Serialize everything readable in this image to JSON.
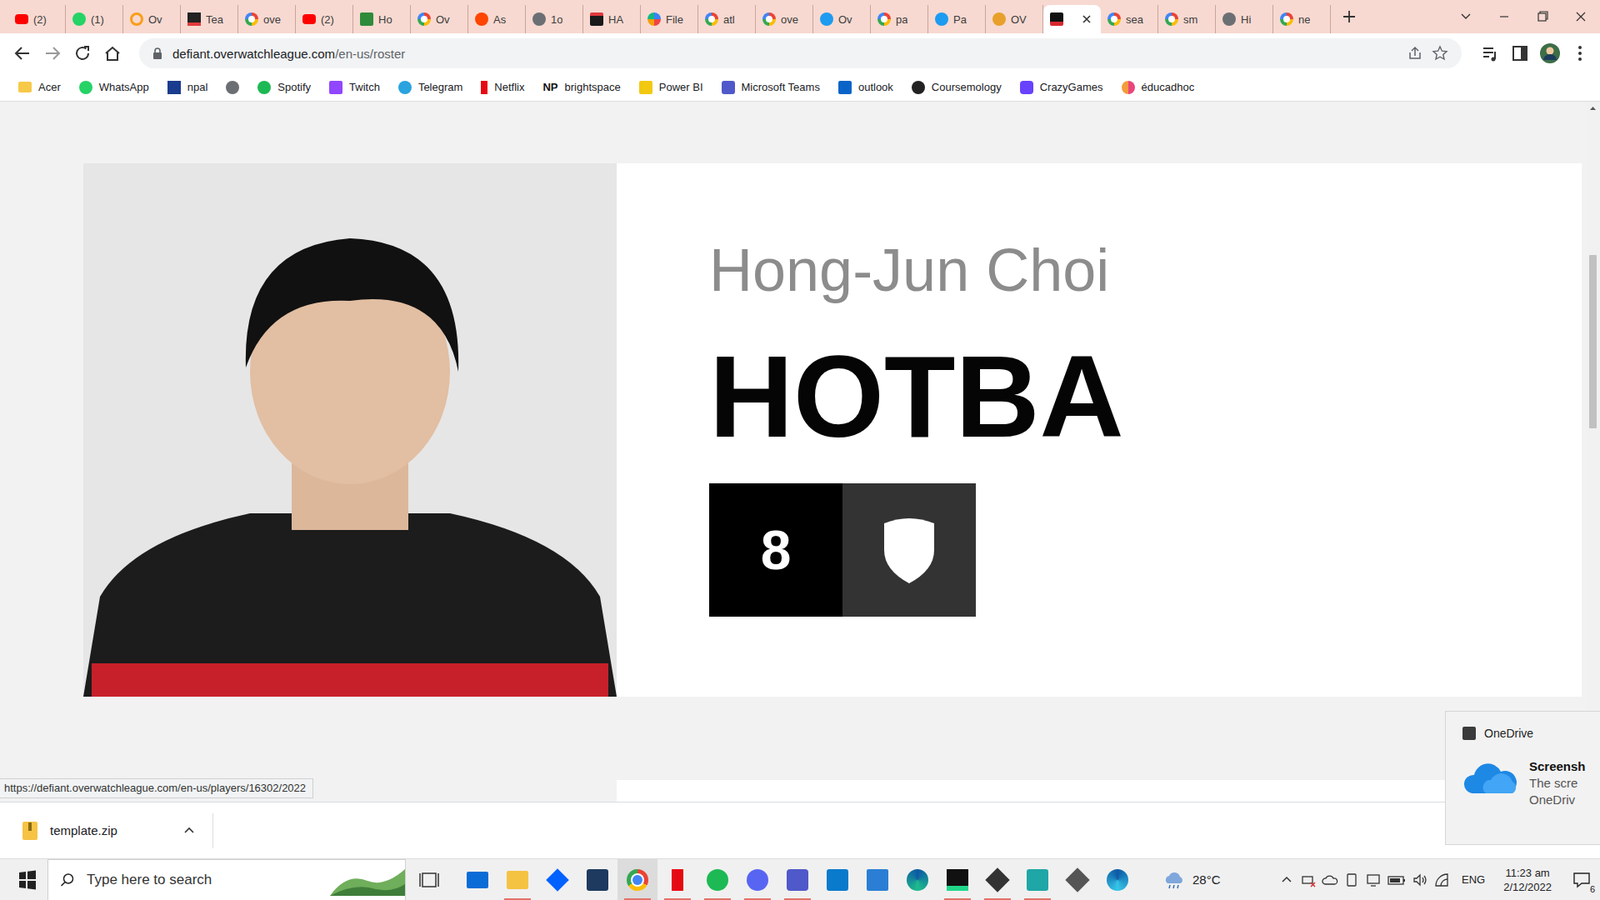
{
  "tabs": [
    {
      "label": "(2)",
      "selected": false,
      "kind": "youtube"
    },
    {
      "label": "(1)",
      "selected": false,
      "kind": "whatsapp"
    },
    {
      "label": "Ov",
      "selected": false,
      "kind": "overwatch"
    },
    {
      "label": "Tea",
      "selected": false,
      "kind": "team"
    },
    {
      "label": "ove",
      "selected": false,
      "kind": "google"
    },
    {
      "label": "(2)",
      "selected": false,
      "kind": "youtube"
    },
    {
      "label": "Ho",
      "selected": false,
      "kind": "wiki"
    },
    {
      "label": "Ov",
      "selected": false,
      "kind": "google"
    },
    {
      "label": "As",
      "selected": false,
      "kind": "reddit"
    },
    {
      "label": "1o",
      "selected": false,
      "kind": "globe"
    },
    {
      "label": "HA",
      "selected": false,
      "kind": "hotba"
    },
    {
      "label": "File",
      "selected": false,
      "kind": "file"
    },
    {
      "label": "atl",
      "selected": false,
      "kind": "google"
    },
    {
      "label": "ove",
      "selected": false,
      "kind": "google"
    },
    {
      "label": "Ov",
      "selected": false,
      "kind": "twitter"
    },
    {
      "label": "pa",
      "selected": false,
      "kind": "google"
    },
    {
      "label": "Pa",
      "selected": false,
      "kind": "twitter"
    },
    {
      "label": "OV",
      "selected": false,
      "kind": "ow"
    },
    {
      "label": "",
      "selected": true,
      "kind": "defiant"
    },
    {
      "label": "sea",
      "selected": false,
      "kind": "google"
    },
    {
      "label": "sm",
      "selected": false,
      "kind": "google"
    },
    {
      "label": "Hi",
      "selected": false,
      "kind": "globe"
    },
    {
      "label": "ne",
      "selected": false,
      "kind": "google"
    }
  ],
  "toolbar": {
    "url_host": "defiant.overwatchleague.com",
    "url_path": "/en-us/roster"
  },
  "bookmarks": [
    {
      "label": "Acer",
      "kind": "folder"
    },
    {
      "label": "WhatsApp",
      "kind": "whatsapp"
    },
    {
      "label": "npal",
      "kind": "npal"
    },
    {
      "kind": "globe"
    },
    {
      "label": "Spotify",
      "kind": "spotify"
    },
    {
      "label": "Twitch",
      "kind": "twitch"
    },
    {
      "label": "Telegram",
      "kind": "telegram"
    },
    {
      "label": "Netflix",
      "kind": "netflix"
    },
    {
      "label": "brightspace",
      "kind": "badge",
      "icon_text": "NP"
    },
    {
      "label": "Power BI",
      "kind": "powerbi"
    },
    {
      "label": "Microsoft Teams",
      "kind": "teams"
    },
    {
      "label": "outlook",
      "kind": "outlook"
    },
    {
      "label": "Coursemology",
      "kind": "coursemology"
    },
    {
      "label": "CrazyGames",
      "kind": "crazygames"
    },
    {
      "label": "éducadhoc",
      "kind": "educadhoc"
    }
  ],
  "player": {
    "real_name": "Hong-Jun Choi",
    "handle": "HOTBA",
    "number": "8"
  },
  "status_url": "https://defiant.overwatchleague.com/en-us/players/16302/2022",
  "downloads": [
    {
      "name": "template.zip"
    }
  ],
  "notification": {
    "app": "OneDrive",
    "title": "Screensh",
    "lines": [
      "The scre",
      "OneDriv"
    ]
  },
  "taskbar": {
    "search_placeholder": "Type here to search",
    "apps": [
      {
        "kind": "mail",
        "running": false,
        "selected": false
      },
      {
        "kind": "explorer",
        "running": true,
        "selected": false
      },
      {
        "kind": "dropbox",
        "running": false,
        "selected": false
      },
      {
        "kind": "store",
        "running": false,
        "selected": false
      },
      {
        "kind": "chrome",
        "running": true,
        "selected": true
      },
      {
        "kind": "netflix",
        "running": true,
        "selected": false
      },
      {
        "kind": "spotify",
        "running": true,
        "selected": false
      },
      {
        "kind": "discord",
        "running": true,
        "selected": false
      },
      {
        "kind": "teams",
        "running": true,
        "selected": false
      },
      {
        "kind": "vscode",
        "running": false,
        "selected": false
      },
      {
        "kind": "photos",
        "running": false,
        "selected": false
      },
      {
        "kind": "edge",
        "running": false,
        "selected": false
      },
      {
        "kind": "pycharm",
        "running": true,
        "selected": false
      },
      {
        "kind": "unity",
        "running": true,
        "selected": false
      },
      {
        "kind": "maya",
        "running": true,
        "selected": false
      },
      {
        "kind": "unityhub",
        "running": false,
        "selected": false
      },
      {
        "kind": "edgebeta",
        "running": false,
        "selected": false
      }
    ],
    "weather": "28°C",
    "language": "ENG",
    "time": "11:23 am",
    "date": "2/12/2022",
    "notifications": "6"
  }
}
